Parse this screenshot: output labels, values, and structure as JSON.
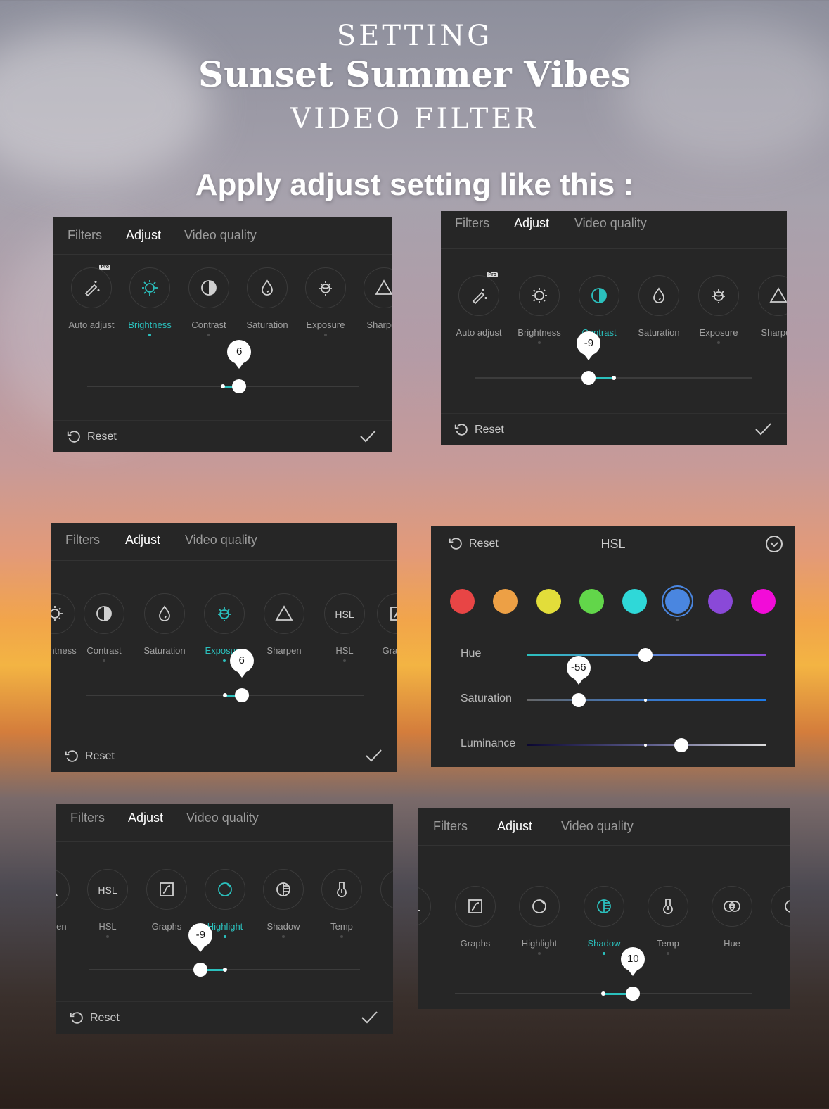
{
  "header": {
    "line1": "SETTING",
    "title": "Sunset Summer Vibes",
    "line3": "VIDEO FILTER",
    "instruction": "Apply adjust setting like this :"
  },
  "accent_color": "#2bc0bd",
  "panels": [
    {
      "tabs": [
        "Filters",
        "Adjust",
        "Video quality"
      ],
      "active_tab": 1,
      "value": 6,
      "value_label": "6",
      "reset_label": "Reset",
      "items": [
        {
          "label": "Auto adjust",
          "icon": "magic-wand",
          "pro": "Pro"
        },
        {
          "label": "Brightness",
          "icon": "sun",
          "active": true,
          "dot": true
        },
        {
          "label": "Contrast",
          "icon": "contrast",
          "dot": true
        },
        {
          "label": "Saturation",
          "icon": "drop"
        },
        {
          "label": "Exposure",
          "icon": "exposure",
          "dot": true
        },
        {
          "label": "Sharpen",
          "icon": "triangle"
        }
      ]
    },
    {
      "tabs": [
        "Filters",
        "Adjust",
        "Video quality"
      ],
      "active_tab": 1,
      "value": -9,
      "value_label": "-9",
      "reset_label": "Reset",
      "items": [
        {
          "label": "Auto adjust",
          "icon": "magic-wand",
          "pro": "Pro"
        },
        {
          "label": "Brightness",
          "icon": "sun",
          "dot": true
        },
        {
          "label": "Contrast",
          "icon": "contrast",
          "active": true,
          "dot": true
        },
        {
          "label": "Saturation",
          "icon": "drop"
        },
        {
          "label": "Exposure",
          "icon": "exposure",
          "dot": true
        },
        {
          "label": "Sharpen",
          "icon": "triangle"
        }
      ]
    },
    {
      "tabs": [
        "Filters",
        "Adjust",
        "Video quality"
      ],
      "active_tab": 1,
      "value": 6,
      "value_label": "6",
      "reset_label": "Reset",
      "items": [
        {
          "label": "Brightness",
          "icon": "sun"
        },
        {
          "label": "Contrast",
          "icon": "contrast",
          "dot": true
        },
        {
          "label": "Saturation",
          "icon": "drop"
        },
        {
          "label": "Exposure",
          "icon": "exposure",
          "active": true,
          "dot": true
        },
        {
          "label": "Sharpen",
          "icon": "triangle"
        },
        {
          "label": "HSL",
          "icon": "hsl",
          "dot": true
        },
        {
          "label": "Graphs",
          "icon": "graphs"
        }
      ]
    },
    {
      "tabs": [
        "Filters",
        "Adjust",
        "Video quality"
      ],
      "active_tab": 1,
      "value": -9,
      "value_label": "-9",
      "reset_label": "Reset",
      "items": [
        {
          "label": "Sharpen",
          "icon": "triangle"
        },
        {
          "label": "HSL",
          "icon": "hsl",
          "dot": true
        },
        {
          "label": "Graphs",
          "icon": "graphs"
        },
        {
          "label": "Highlight",
          "icon": "highlight",
          "active": true,
          "dot": true
        },
        {
          "label": "Shadow",
          "icon": "shadow",
          "dot": true
        },
        {
          "label": "Temp",
          "icon": "temp",
          "dot": true
        },
        {
          "label": "",
          "icon": "circle"
        }
      ]
    },
    {
      "tabs": [
        "Filters",
        "Adjust",
        "Video quality"
      ],
      "active_tab": 1,
      "value": 10,
      "value_label": "10",
      "items": [
        {
          "label": "",
          "icon": "hsl"
        },
        {
          "label": "Graphs",
          "icon": "graphs"
        },
        {
          "label": "Highlight",
          "icon": "highlight",
          "dot": true
        },
        {
          "label": "Shadow",
          "icon": "shadow",
          "active": true,
          "dot": true
        },
        {
          "label": "Temp",
          "icon": "temp",
          "dot": true
        },
        {
          "label": "Hue",
          "icon": "hue"
        },
        {
          "label": "",
          "icon": "circle"
        }
      ]
    }
  ],
  "hsl": {
    "title": "HSL",
    "reset_label": "Reset",
    "swatches": [
      "#e84545",
      "#eda045",
      "#e2dd3a",
      "#62d64a",
      "#2fd8d8",
      "#4a86e0",
      "#8a49d8",
      "#f20cd8"
    ],
    "selected_swatch": 5,
    "sliders": [
      {
        "label": "Hue",
        "value": 0
      },
      {
        "label": "Saturation",
        "value": -56,
        "value_label": "-56"
      },
      {
        "label": "Luminance",
        "value": 30
      }
    ]
  }
}
